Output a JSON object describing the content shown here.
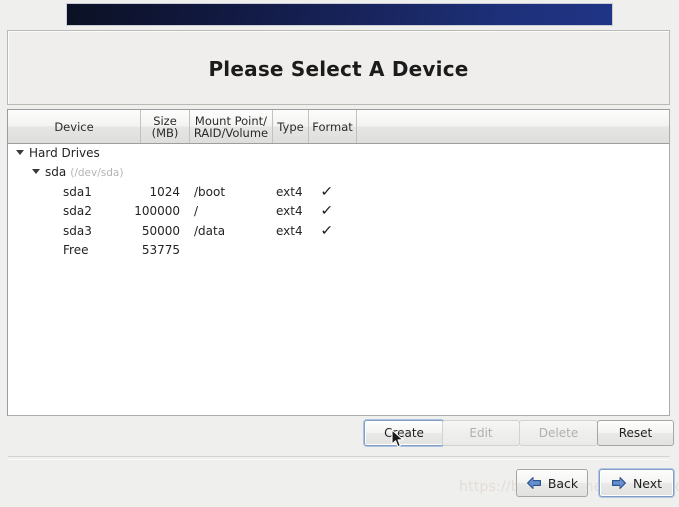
{
  "window": {
    "background_color": "#efefee",
    "banner": {
      "name": "installer-banner",
      "gradient_from": "#0b1124",
      "gradient_to": "#203486"
    }
  },
  "header": {
    "title": "Please Select A Device"
  },
  "device_table": {
    "columns": [
      {
        "key": "device",
        "label": "Device"
      },
      {
        "key": "size",
        "label_line1": "Size",
        "label_line2": "(MB)"
      },
      {
        "key": "mount",
        "label_line1": "Mount Point/",
        "label_line2": "RAID/Volume"
      },
      {
        "key": "type",
        "label": "Type"
      },
      {
        "key": "format",
        "label": "Format"
      }
    ],
    "rows": [
      {
        "name": "Hard Drives",
        "level": 0,
        "expanded": true,
        "has_twisty": true,
        "detail": "",
        "size": "",
        "mount": "",
        "type": "",
        "format": ""
      },
      {
        "name": "sda",
        "level": 1,
        "expanded": true,
        "has_twisty": true,
        "detail": "(/dev/sda)",
        "size": "",
        "mount": "",
        "type": "",
        "format": ""
      },
      {
        "name": "sda1",
        "level": 2,
        "expanded": false,
        "has_twisty": false,
        "detail": "",
        "size": "1024",
        "mount": "/boot",
        "type": "ext4",
        "format": "✓"
      },
      {
        "name": "sda2",
        "level": 2,
        "expanded": false,
        "has_twisty": false,
        "detail": "",
        "size": "100000",
        "mount": "/",
        "type": "ext4",
        "format": "✓"
      },
      {
        "name": "sda3",
        "level": 2,
        "expanded": false,
        "has_twisty": false,
        "detail": "",
        "size": "50000",
        "mount": "/data",
        "type": "ext4",
        "format": "✓"
      },
      {
        "name": "Free",
        "level": 2,
        "expanded": false,
        "has_twisty": false,
        "detail": "",
        "size": "53775",
        "mount": "",
        "type": "",
        "format": ""
      }
    ]
  },
  "actions": {
    "create": {
      "label": "Create",
      "enabled": true,
      "focused": true
    },
    "edit": {
      "label": "Edit",
      "enabled": false,
      "focused": false
    },
    "delete": {
      "label": "Delete",
      "enabled": false,
      "focused": false
    },
    "reset": {
      "label": "Reset",
      "enabled": true,
      "focused": false
    }
  },
  "navigation": {
    "back": {
      "label": "Back",
      "icon": "arrow-left-icon"
    },
    "next": {
      "label": "Next",
      "icon": "arrow-right-icon",
      "focused": true
    }
  },
  "watermark": {
    "text": "https://blog.csdn.net/linuxbobo"
  }
}
